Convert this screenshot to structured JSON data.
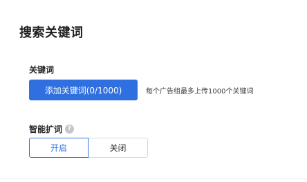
{
  "section": {
    "title": "搜索关键词"
  },
  "keywords": {
    "label": "关键词",
    "add_button": "添加关键词(0/1000)",
    "hint": "每个广告组最多上传1000个关键词"
  },
  "smart_expand": {
    "label": "智能扩词",
    "help_icon_glyph": "?",
    "options": [
      "开启",
      "关闭"
    ],
    "selected": "开启"
  },
  "colors": {
    "accent": "#2f6fe0",
    "border": "#d6d8dc"
  }
}
